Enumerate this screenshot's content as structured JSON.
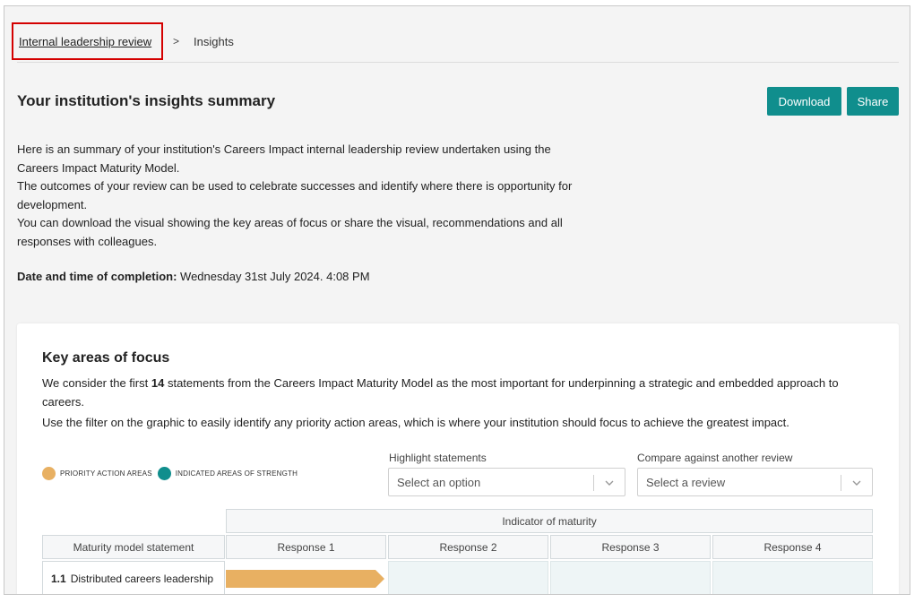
{
  "breadcrumb": {
    "parent": "Internal leadership review",
    "separator": ">",
    "current": "Insights"
  },
  "header": {
    "title": "Your institution's insights summary",
    "download_label": "Download",
    "share_label": "Share"
  },
  "intro": {
    "line1": "Here is an summary of your institution's Careers Impact internal leadership review undertaken using the Careers Impact Maturity Model.",
    "line2": "The outcomes of your review can be used to celebrate successes and identify where there is opportunity for development.",
    "line3": "You can download the visual showing the key areas of focus or share the visual, recommendations and all responses with colleagues."
  },
  "completion": {
    "label": "Date and time of completion:",
    "value": "Wednesday 31st July 2024. 4:08 PM"
  },
  "focus": {
    "title": "Key areas of focus",
    "text_before": "We consider the first ",
    "count": "14",
    "text_after": " statements from the Careers Impact Maturity Model as the most important for underpinning a strategic and embedded approach to careers.",
    "filter_text": "Use the filter on the graphic to easily identify any priority action areas, which is where your institution should focus to achieve the greatest impact."
  },
  "legend": {
    "priority": "PRIORITY ACTION AREAS",
    "strength": "INDICATED AREAS OF STRENGTH"
  },
  "filters": {
    "highlight_label": "Highlight statements",
    "highlight_placeholder": "Select an option",
    "compare_label": "Compare against another review",
    "compare_placeholder": "Select a review"
  },
  "table": {
    "group_header": "Indicator of maturity",
    "statement_header": "Maturity model statement",
    "responses": [
      "Response 1",
      "Response 2",
      "Response 3",
      "Response 4"
    ],
    "rows": [
      {
        "number": "1.1",
        "label": "Distributed careers leadership",
        "response_level": 1,
        "status": "priority"
      }
    ]
  },
  "colors": {
    "accent": "#108e8d",
    "priority": "#e8b062",
    "strength": "#108e8d",
    "highlight_border": "#d40000"
  }
}
